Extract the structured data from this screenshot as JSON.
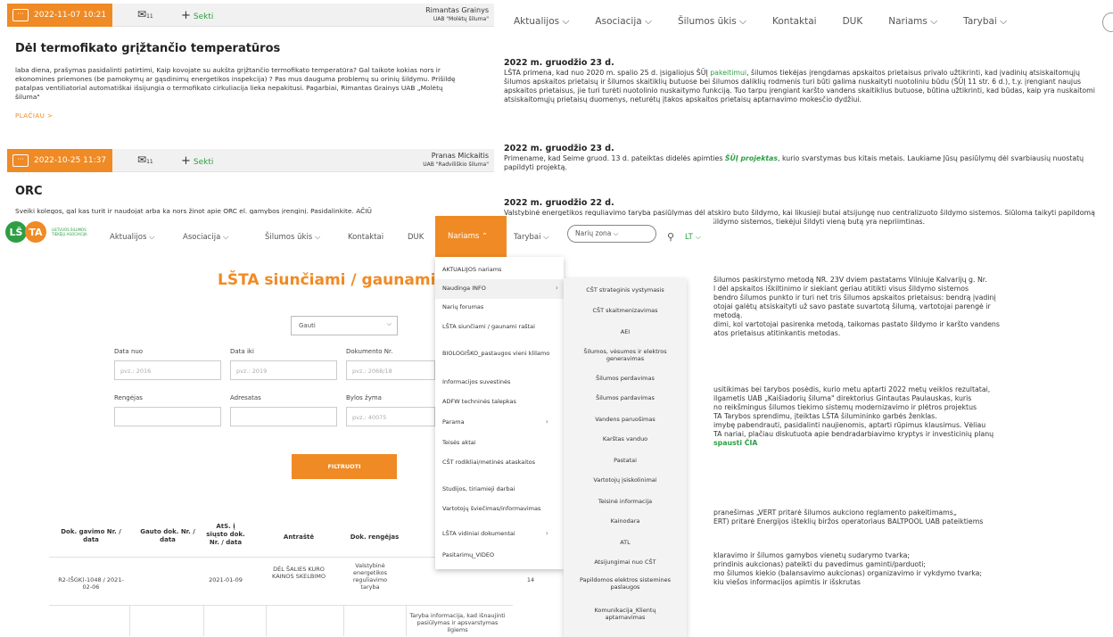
{
  "forum": {
    "posts": [
      {
        "date": "2022-11-07  10:21",
        "mail_count": "11",
        "follow": "Sekti",
        "author": "Rimantas Grainys",
        "company": "UAB \"Molėtų šiluma\"",
        "title": "Dėl termofikato grįžtančio temperatūros",
        "body": "laba diena, prašymas pasidalinti patirtimi, Kaip kovojate su aukšta grįžtančio termofikato temperatūra? Gal taikote kokias nors ir ekonomines priemones (be pamokymų ar gąsdinimų energetikos inspekcija) ? Pas mus dauguma problemų su orinių šildymu. Prišildę patalpas ventiliatorial automatiškai išsijungia o termofikato cirkuliacija lieka nepakitusi. Pagarbiai, Rimantas Grainys UAB „Molėtų šiluma\"",
        "more": "PLAČIAU  >"
      },
      {
        "date": "2022-10-25  11:37",
        "mail_count": "11",
        "follow": "Sekti",
        "author": "Pranas Mickaitis",
        "company": "UAB \"Radviliškio šiluma\"",
        "title": "ORC",
        "body": "Sveiki kolegos, gal kas turit ir naudojat arba ka nors žinot apie ORC el. gamybos įrenginį. Pasidalinkite. AČIŪ"
      }
    ]
  },
  "top_nav": [
    "Aktualijos ⌵",
    "Asociacija ⌵",
    "Šilumos ūkis ⌵",
    "Kontaktai",
    "DUK",
    "Nariams ⌵",
    "Tarybai ⌵"
  ],
  "news": [
    {
      "date": "2022 m. gruodžio 23 d.",
      "text_a": "LŠTA primena, kad nuo 2020 m. spalio 25 d. įsigaliojus ŠŪĮ ",
      "link": "pakeitimui",
      "text_b": ", šilumos tiekėjas įrengdamas apskaitos prietaisus privalo užtikrinti, kad įvadinių atsiskaitomųjų šilumos apskaitos prietaisų ir šilumos skaitiklių butuose bei šilumos daliklių rodmenis turi būti galima nuskaityti nuotoliniu būdu (ŠŪĮ 11 str. 6 d.), t.y. įrengiant naujus apskaitos prietaisus, jie turi turėti nuotolinio nuskaitymo funkciją. Tuo tarpu įrengiant karšto vandens skaitiklius butuose, būtina užtikrinti, kad būdas, kaip yra nuskaitomi atsiskaitomųjų prietaisų duomenys, neturėtų įtakos apskaitos prietaisų aptarnavimo mokesčio dydžiui."
    },
    {
      "date": "2022 m. gruodžio 23 d.",
      "text_a": "Primename, kad Seime gruod. 13 d. pateiktas didelės apimties ",
      "link": "ŠŪĮ projektas",
      "text_b": ", kurio svarstymas bus kitais metais. Laukiame Jūsų pasiūlymų dėl svarbiausių nuostatų papildyti projektą."
    },
    {
      "date": "2022 m. gruodžio 22 d.",
      "text_a": "Valstybinė energetikos reguliavimo taryba pasiūlymas dėl atskiro buto šildymo, kai likusieji butai atsijungę nuo centralizuoto šildymo sistemos. Siūloma taikyti papildomą reglamentavimą, kuris padėtų daugiabučių namų butų nuo šildymo sistemos, tiekėjui šildyti vieną butą yra nepriimtinas.",
      "link": "",
      "text_b": ""
    }
  ],
  "right_lower": [
    "šilumos paskirstymo metodą NR. 23V dviem pastatams Vilniuje Kalvarijų g. Nr.",
    "l dėl apskaitos iškiltinimo ir siekiant geriau atitikti visus šildymo sistemos",
    "bendro šilumos punkto ir turi net tris šilumos apskaitos prietaisus: bendrą įvadinį",
    "otojai galėtų atsiskaityti už savo pastate suvartotą šilumą, vartotojai parengė ir",
    " metodą.",
    "dimi, kol vartotojai pasirenka metodą, taikomas pastato šildymo ir karšto vandens",
    "atos prietaisus atitinkantis metodas."
  ],
  "right_lower2": [
    "usitikimas bei tarybos posėdis, kurio metu aptarti 2022 metų veiklos rezultatai,",
    "ilgametis UAB „Kaišiadorių šiluma\" direktorius Gintautas Paulauskas, kuris",
    "no reikšmingus šilumos tiekimo sistemų modernizavimo ir plėtros projektus",
    "TA Tarybos sprendimu, įteiktas LŠTA šilumininko garbės ženklas.",
    "imybę pabendrauti, pasidalinti naujienomis, aptarti rūpimus klausimus. Vėliau",
    "TA nariai, plačiau diskutuota apie bendradarbiavimo kryptys ir investicinių planų"
  ],
  "right_lower2_link": "spausti ČIA",
  "right_lower3": [
    "pranešimas „VERT pritarė šilumos aukciono reglamento pakeitimams„",
    "ERT) pritarė Energijos išteklių biržos operatoriaus BALTPOOL UAB pateiktiems"
  ],
  "right_lower4": [
    "klaravimo ir šilumos gamybos vienetų sudarymo tvarka;",
    "prindinis aukcionas) pateikti du pavedimus gaminti/parduoti;",
    "mo šilumos kiekio (balansavimo aukcionas) organizavimo ir vykdymo tvarka;",
    "kiu viešos informacijos apimtis ir išskrutas"
  ],
  "site": {
    "logo_letters": "LŠTA",
    "logo_subtitle": "LIETUVOS ŠILUMOS TIEKĖJŲ ASOCIACIJA",
    "nav": [
      "Aktualijos ⌵",
      "Asociacija ⌵",
      "Šilumos ūkis ⌵",
      "Kontaktai",
      "DUK"
    ],
    "nav_active": "Nariams ⌃",
    "nav_tarybai": "Tarybai ⌵",
    "search_pill": "Narių zona ⌵",
    "lang": "LT ⌵",
    "page_title": "LŠTA siunčiami / gaunami ra",
    "select_value": "Gauti",
    "filters": {
      "data_nuo": "Data nuo",
      "data_nuo_ph": "pvz.: 2016",
      "data_iki": "Data iki",
      "data_iki_ph": "pvz.: 2019",
      "dok_nr": "Dokumento Nr.",
      "dok_nr_ph": "pvz.: 2068/18",
      "rengejas": "Rengėjas",
      "adresatas": "Adresatas",
      "bylos_zyma": "Bylos žyma",
      "bylos_ph": "pvz.: 40075"
    },
    "filter_button": "FILTRUOTI",
    "table_headers": [
      "Dok. gavimo Nr. / data",
      "Gauto dok. Nr. / data",
      "AtS. į siųsto dok. Nr. / data",
      "Antraštė",
      "Dok. rengėjas"
    ],
    "row": {
      "c1": "R2-(ŠGK)-1048 / 2021-02-06",
      "c3": "2021-01-09",
      "c4": "DĖL ŠALIES KURO KAINOS SKELBIMO",
      "c5": "Valstybinė energetikos reguliavimo taryba",
      "c7": "14"
    },
    "row2_note": "Taryba informacija, kad išnaujinti pasiūlymas ir apsvarstymas ilgiems"
  },
  "menu1": {
    "items": [
      "AKTUALIJOS nariams",
      "Naudinga INFO",
      "Narių forumas",
      "LŠTA siunčiami / gaunami raštai",
      "BIOLOGIŠKO_pastaugos vieni klilamo",
      "Informacijos suvestinės",
      "ADFW techninės talepkas",
      "Parama",
      "Teisės aktai",
      "CŠT rodikliai/metinės ataskaitos",
      "Studijos, tiriamieji darbai",
      "Vartotojų šviečimas/informavimas",
      "LŠTA vidiniai dokumentai",
      "Pasitarimų_VIDEO"
    ]
  },
  "menu2": {
    "items": [
      "CŠT strateginis vystymasis",
      "CŠT skaitmenizavimas",
      "AEI",
      "Šilumos, vėsumos ir elektros generavimas",
      "Šilumos perdavimas",
      "Šilumos pardavimas",
      "Vandens paruošimas",
      "Karštas vanduo",
      "Pastatai",
      "Vartotojų įsiskolinimai",
      "Teisinė informacija",
      "Kainodara",
      "ATL",
      "Atsijungimai nuo CŠT",
      "Papildomos elektros sistemines paslaugos",
      "Komunikacija_Klientų aptarnavimas"
    ]
  }
}
